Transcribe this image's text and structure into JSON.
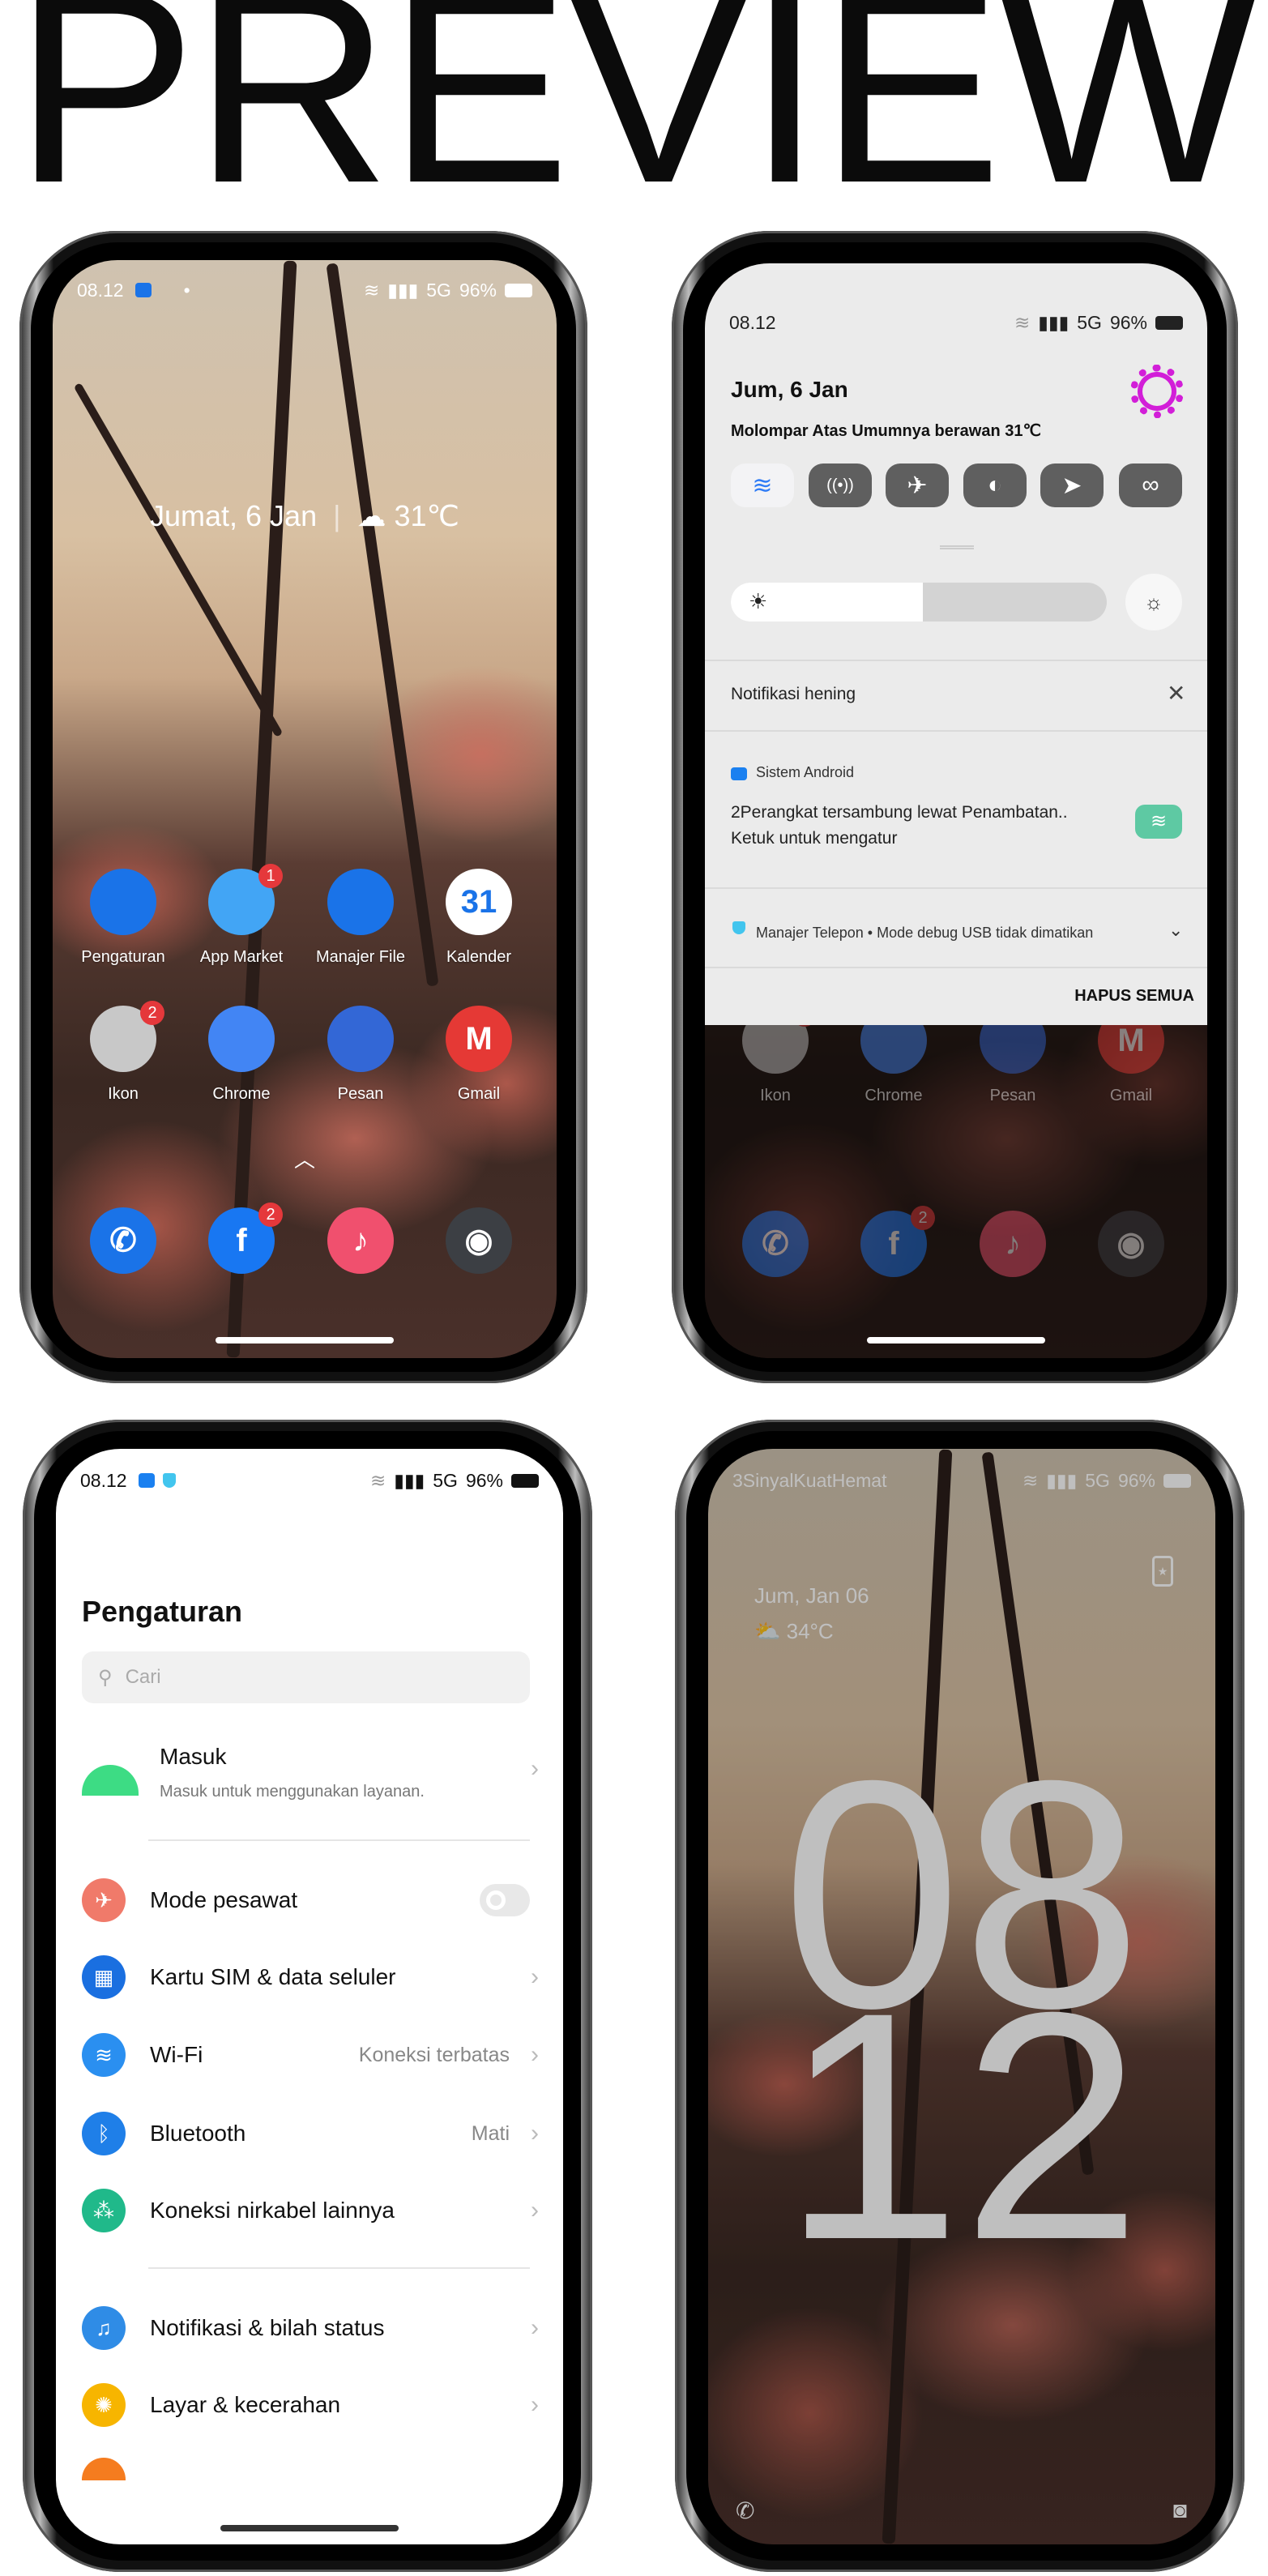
{
  "title": "PREVIEW",
  "status": {
    "time": "08.12",
    "network": "5G",
    "battery": "96%"
  },
  "home": {
    "date_weather": "Jumat, 6 Jan",
    "temp": "31℃",
    "apps": [
      {
        "label": "Pengaturan",
        "icon": "gear-icon",
        "color": "#1a73e8"
      },
      {
        "label": "App Market",
        "icon": "shopping-bag-icon",
        "color": "#42a5f5",
        "badge": "1"
      },
      {
        "label": "Manajer File",
        "icon": "folder-icon",
        "color": "#1a73e8"
      },
      {
        "label": "Kalender",
        "icon": "calendar-icon",
        "color": "#ffffff",
        "text": "31"
      },
      {
        "label": "Ikon",
        "icon": "folder-group-icon",
        "color": "#c8c8c8",
        "badge": "2"
      },
      {
        "label": "Chrome",
        "icon": "chrome-icon",
        "color": "#4285f4"
      },
      {
        "label": "Pesan",
        "icon": "messages-icon",
        "color": "#3367d6"
      },
      {
        "label": "Gmail",
        "icon": "gmail-icon",
        "color": "#e53935",
        "text": "M"
      }
    ],
    "dock": [
      {
        "icon": "phone-icon",
        "color": "#1a73e8",
        "glyph": "✆"
      },
      {
        "icon": "facebook-icon",
        "color": "#1877f2",
        "glyph": "f",
        "badge": "2"
      },
      {
        "icon": "music-icon",
        "color": "#f0506e",
        "glyph": "♪"
      },
      {
        "icon": "camera-icon",
        "color": "#3c3f44",
        "glyph": "◉"
      }
    ]
  },
  "quick_settings": {
    "date": "Jum, 6 Jan",
    "weather": "Molompar Atas Umumnya berawan 31℃",
    "tiles": [
      {
        "icon": "wifi-icon",
        "active": true
      },
      {
        "icon": "hotspot-icon",
        "active": false
      },
      {
        "icon": "airplane-icon",
        "active": false
      },
      {
        "icon": "dark-mode-icon",
        "active": false
      },
      {
        "icon": "location-icon",
        "active": false
      },
      {
        "icon": "link-icon",
        "active": false
      }
    ],
    "brightness": 0.51,
    "silent_header": "Notifikasi hening",
    "notification": {
      "app": "Sistem Android",
      "line1": "2Perangkat tersambung lewat Penambatan..",
      "line2": "Ketuk untuk mengatur"
    },
    "notification2": {
      "app": "Manajer Telepon",
      "text": "Mode debug USB tidak dimatikan"
    },
    "clear_all": "HAPUS SEMUA",
    "gear_color": "#d21ed8"
  },
  "settings": {
    "title": "Pengaturan",
    "search_placeholder": "Cari",
    "account": {
      "title": "Masuk",
      "subtitle": "Masuk untuk menggunakan layanan."
    },
    "items": [
      {
        "label": "Mode pesawat",
        "icon": "airplane-icon",
        "color": "#f07a6a",
        "toggle": false
      },
      {
        "label": "Kartu SIM & data seluler",
        "icon": "sim-card-icon",
        "color": "#1a6fe0"
      },
      {
        "label": "Wi-Fi",
        "icon": "wifi-icon",
        "color": "#2a8ff0",
        "value": "Koneksi terbatas"
      },
      {
        "label": "Bluetooth",
        "icon": "bluetooth-icon",
        "color": "#1f7fe8",
        "value": "Mati"
      },
      {
        "label": "Koneksi nirkabel lainnya",
        "icon": "connections-icon",
        "color": "#20b98a"
      },
      {
        "label": "Notifikasi & bilah status",
        "icon": "bell-icon",
        "color": "#2f8ce6"
      },
      {
        "label": "Layar & kecerahan",
        "icon": "brightness-icon",
        "color": "#f7b500"
      }
    ]
  },
  "lock": {
    "carrier": "3SinyalKuatHemat",
    "date": "Jum, Jan 06",
    "temp": "34°C",
    "hour": "08",
    "minute": "12"
  }
}
